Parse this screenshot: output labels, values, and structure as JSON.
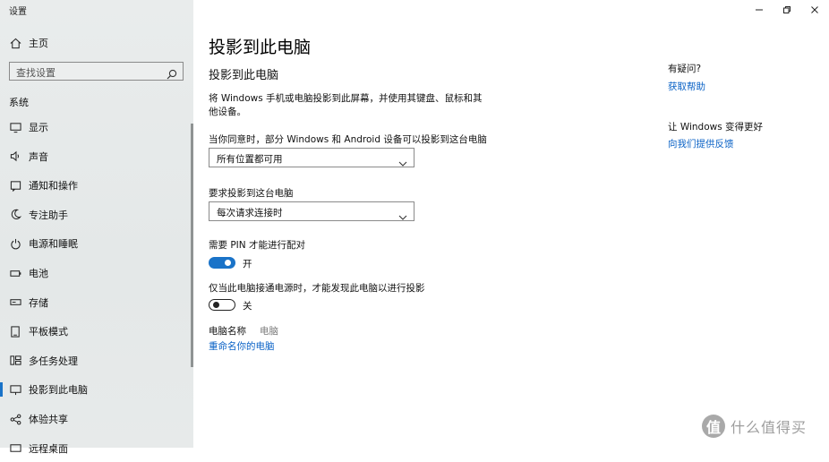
{
  "window": {
    "app_title": "设置",
    "controls": {
      "minimize": "—",
      "maximize": "☐",
      "close": "✕"
    }
  },
  "sidebar": {
    "home_label": "主页",
    "search_placeholder": "查找设置",
    "section_label": "系统",
    "items": [
      {
        "label": "显示",
        "icon": "monitor-icon"
      },
      {
        "label": "声音",
        "icon": "speaker-icon"
      },
      {
        "label": "通知和操作",
        "icon": "notification-icon"
      },
      {
        "label": "专注助手",
        "icon": "moon-icon"
      },
      {
        "label": "电源和睡眠",
        "icon": "power-icon"
      },
      {
        "label": "电池",
        "icon": "battery-icon"
      },
      {
        "label": "存储",
        "icon": "storage-icon"
      },
      {
        "label": "平板模式",
        "icon": "tablet-icon"
      },
      {
        "label": "多任务处理",
        "icon": "multitask-icon"
      },
      {
        "label": "投影到此电脑",
        "icon": "project-icon",
        "active": true
      },
      {
        "label": "体验共享",
        "icon": "share-icon"
      },
      {
        "label": "远程桌面",
        "icon": "remote-desktop-icon"
      }
    ]
  },
  "main": {
    "page_title": "投影到此电脑",
    "subtitle": "投影到此电脑",
    "description": "将 Windows 手机或电脑投影到此屏幕，并使用其键盘、鼠标和其他设备。",
    "availability_label": "当你同意时，部分 Windows 和 Android 设备可以投影到这台电脑",
    "availability_value": "所有位置都可用",
    "request_label": "要求投影到这台电脑",
    "request_value": "每次请求连接时",
    "pin_label": "需要 PIN 才能进行配对",
    "pin_state": "开",
    "pin_on": true,
    "power_label": "仅当此电脑接通电源时，才能发现此电脑以进行投影",
    "power_state": "关",
    "power_on": false,
    "pc_name_label": "电脑名称",
    "pc_name_value": "电脑",
    "rename_link": "重命名你的电脑"
  },
  "help": {
    "question": "有疑问?",
    "get_help": "获取帮助",
    "improve": "让 Windows 变得更好",
    "feedback": "向我们提供反馈"
  },
  "watermark": {
    "glyph": "值",
    "text": "什么值得买"
  },
  "colors": {
    "accent": "#1a73c8",
    "link": "#0a62c6",
    "sidebar_bg": "#e7eaea"
  }
}
